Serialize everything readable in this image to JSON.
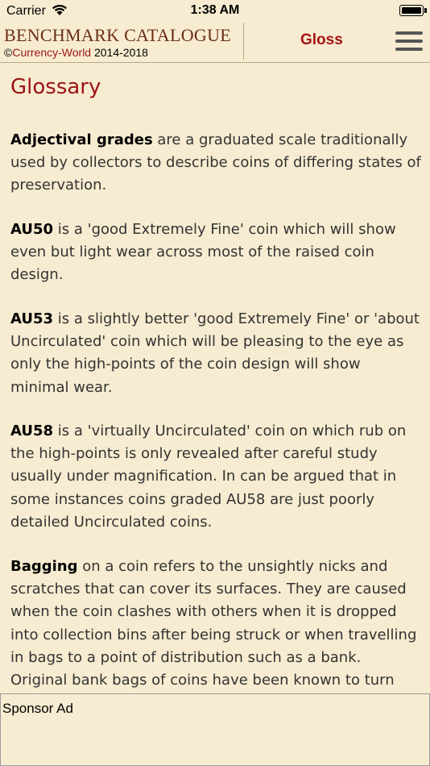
{
  "status_bar": {
    "carrier": "Carrier",
    "time": "1:38 AM",
    "icons": [
      "wifi-icon",
      "battery-icon"
    ]
  },
  "header": {
    "brand_title": "BENCHMARK CATALOGUE",
    "copyright_symbol": "©",
    "brand_name": "Currency-World",
    "years": " 2014-2018",
    "section_tab": "Gloss",
    "menu_icon": "hamburger-menu-icon"
  },
  "page": {
    "title": "Glossary",
    "entries": [
      {
        "term": "Adjectival grades",
        "text": " are a graduated scale traditionally used by collectors to describe coins of differing states of preservation."
      },
      {
        "term": "AU50",
        "text": " is a 'good Extremely Fine' coin which will show even but light wear across most of the raised coin design."
      },
      {
        "term": "AU53",
        "text": " is a slightly better 'good Extremely Fine' or 'about Uncirculated' coin which will be pleasing to the eye as only the high-points of the coin design will show minimal wear."
      },
      {
        "term": "AU58",
        "text": " is a 'virtually Uncirculated' coin on which rub on the high-points is only revealed after careful study usually under magnification. In can be argued that in some instances coins graded AU58 are just poorly detailed Uncirculated coins."
      },
      {
        "term": "Bagging",
        "text": " on a coin refers to the unsightly nicks and scratches that can cover its surfaces. They are caused when the coin clashes with others when it is dropped into collection bins after being struck or when travelling in bags to a point of distribution such as a bank. Original bank bags of coins have been known to turn"
      }
    ]
  },
  "ad": {
    "label": "Sponsor Ad"
  },
  "colors": {
    "background": "#f7ecd1",
    "accent_red": "#9c1414",
    "brand_brown": "#6b2d16"
  }
}
